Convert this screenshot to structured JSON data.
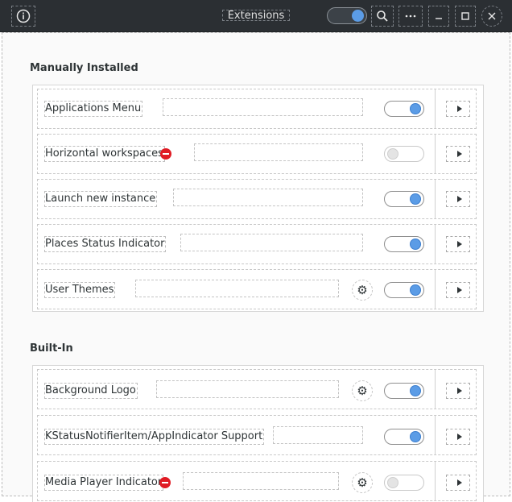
{
  "titlebar": {
    "title": "Extensions",
    "info_icon": "info-icon",
    "search_icon": "search-icon",
    "menu_icon": "ellipsis-icon",
    "minimize_icon": "minimize-icon",
    "maximize_icon": "maximize-icon",
    "close_icon": "close-icon",
    "global_toggle": true
  },
  "sections": [
    {
      "title": "Manually Installed",
      "extensions": [
        {
          "name": "Applications Menu",
          "enabled": true,
          "error": false,
          "settings": false
        },
        {
          "name": "Horizontal workspaces",
          "enabled": false,
          "error": true,
          "settings": false
        },
        {
          "name": "Launch new instance",
          "enabled": true,
          "error": false,
          "settings": false
        },
        {
          "name": "Places Status Indicator",
          "enabled": true,
          "error": false,
          "settings": false
        },
        {
          "name": "User Themes",
          "enabled": true,
          "error": false,
          "settings": true
        }
      ]
    },
    {
      "title": "Built-In",
      "extensions": [
        {
          "name": "Background Logo",
          "enabled": true,
          "error": false,
          "settings": true
        },
        {
          "name": "KStatusNotifierItem/AppIndicator Support",
          "enabled": true,
          "error": false,
          "settings": false
        },
        {
          "name": "Media Player Indicator",
          "enabled": false,
          "error": true,
          "settings": true
        }
      ]
    }
  ],
  "colors": {
    "titlebar": "#2b2f33",
    "switch_on": "#5b9ce6",
    "error": "#e01b24"
  }
}
